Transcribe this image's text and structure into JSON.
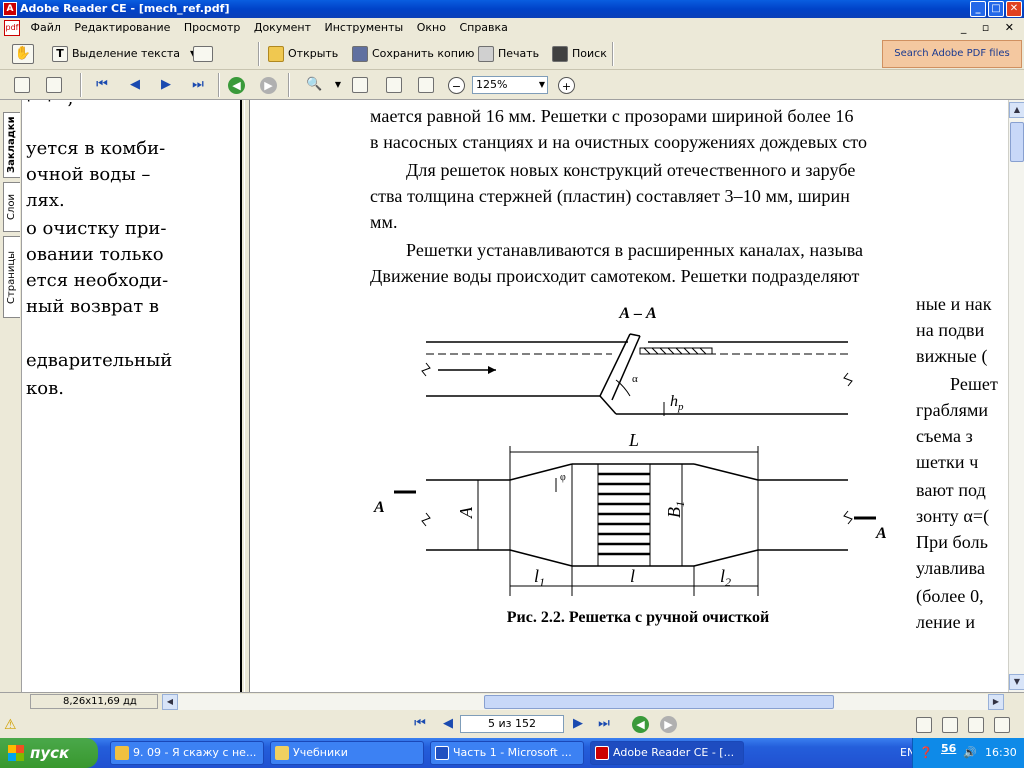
{
  "window": {
    "title": "Adobe Reader CE - [mech_ref.pdf]",
    "app_icon": "adobe-icon"
  },
  "menu": [
    "Файл",
    "Редактирование",
    "Просмотр",
    "Документ",
    "Инструменты",
    "Окно",
    "Справка"
  ],
  "toolbar1": {
    "select_text": "Выделение текста",
    "open": "Открыть",
    "save_copy": "Сохранить копию",
    "print": "Печать",
    "search": "Поиск",
    "search_adobe": "Search Adobe PDF files"
  },
  "toolbar2": {
    "zoom": "125%"
  },
  "side_tabs": [
    "Закладки",
    "Слои",
    "Страницы"
  ],
  "left_pane_lines": [
    "уется в комби-",
    "очной воды –",
    "лях.",
    "о очистку при-",
    "овании только",
    "ется необходи-",
    "ный возврат в",
    "",
    "едварительный",
    "ков."
  ],
  "doc": {
    "lines": [
      "мается равной 16 мм. Решетки с прозорами шириной более 16",
      "в насосных станциях и на очистных сооружениях дождевых сто",
      "Для решеток новых конструкций отечественного и зарубе",
      "ства толщина стержней (пластин) составляет 3–10 мм, ширин",
      "мм.",
      "Решетки устанавливаются в расширенных каналах, называ",
      "Движение воды происходит самотеком. Решетки подразделяют"
    ],
    "right_lines": [
      "ные и нак",
      "на подви",
      "вижные (",
      "Решет",
      "граблями",
      "съема з",
      "шетки ч",
      "вают под",
      "зонту α=(",
      "При боль",
      "улавлива",
      "(более 0,",
      "ление и"
    ],
    "figure": {
      "section_label": "А – А",
      "alpha": "α",
      "hp": "h",
      "hp_sub": "p",
      "L": "L",
      "phi": "φ",
      "A": "A",
      "B1": "B",
      "B1_sub": "1",
      "l1": "l",
      "l1_sub": "1",
      "l": "l",
      "l2": "l",
      "l2_sub": "2",
      "cut_left": "А",
      "cut_right": "А",
      "caption": "Рис. 2.2. Решетка с ручной очисткой"
    }
  },
  "status": {
    "page_size": "8,26x11,69 дд",
    "page_field": "5 из 152"
  },
  "taskbar": {
    "start": "пуск",
    "tasks": [
      "9. 09 - Я скажу с не...",
      "Учебники",
      "Часть 1 - Microsoft ...",
      "Adobe Reader CE - [..."
    ],
    "lang": "EN",
    "time": "16:30",
    "tray_num": "56"
  }
}
